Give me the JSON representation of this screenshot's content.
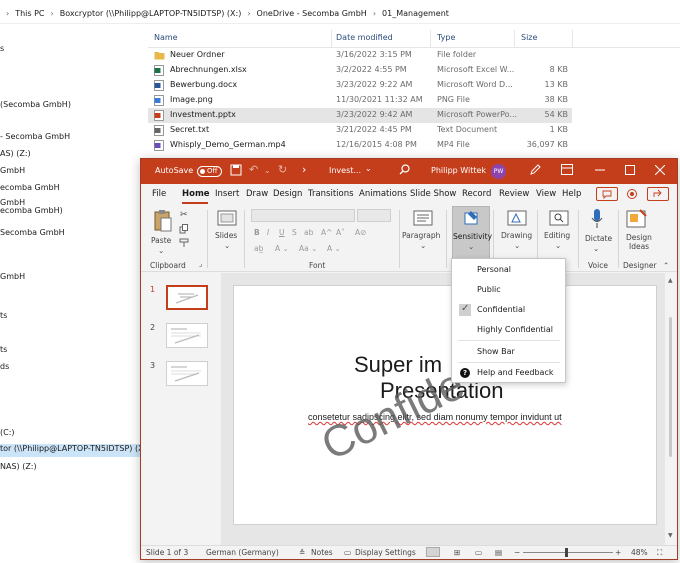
{
  "explorer": {
    "breadcrumb": [
      "This PC",
      "Boxcryptor (\\\\Philipp@LAPTOP-TN5IDTSP) (X:)",
      "OneDrive - Secomba GmbH",
      "01_Management"
    ],
    "nav_items": [
      "s",
      "(Secomba GmbH)",
      "- Secomba GmbH",
      "AS) (Z:)",
      "GmbH",
      "ecomba GmbH",
      "GmbH",
      "ecomba GmbH)",
      "Secomba GmbH",
      "GmbH",
      "ts",
      "ts",
      "ds",
      "(C:)",
      "tor (\\\\Philipp@LAPTOP-TN5IDTSP) (X:)",
      "NAS) (Z:)"
    ],
    "columns": {
      "name": "Name",
      "date": "Date modified",
      "type": "Type",
      "size": "Size"
    },
    "files": [
      {
        "name": "Neuer Ordner",
        "date": "3/16/2022 3:15 PM",
        "type": "File folder",
        "size": "",
        "icon": "folder-icon",
        "color": "#e8b84a"
      },
      {
        "name": "Abrechnungen.xlsx",
        "date": "3/2/2022 4:55 PM",
        "type": "Microsoft Excel W...",
        "size": "8 KB",
        "icon": "excel-file-icon",
        "color": "#1e7145"
      },
      {
        "name": "Bewerbung.docx",
        "date": "3/23/2022 9:22 AM",
        "type": "Microsoft Word D...",
        "size": "13 KB",
        "icon": "word-file-icon",
        "color": "#2b579a"
      },
      {
        "name": "Image.png",
        "date": "11/30/2021 11:32 AM",
        "type": "PNG File",
        "size": "38 KB",
        "icon": "image-file-icon",
        "color": "#3a7bd5"
      },
      {
        "name": "Investment.pptx",
        "date": "3/23/2022 9:42 AM",
        "type": "Microsoft PowerPo...",
        "size": "54 KB",
        "icon": "powerpoint-file-icon",
        "color": "#c43e1c"
      },
      {
        "name": "Secret.txt",
        "date": "3/21/2022 4:45 PM",
        "type": "Text Document",
        "size": "1 KB",
        "icon": "text-file-icon",
        "color": "#666666"
      },
      {
        "name": "Whisply_Demo_German.mp4",
        "date": "12/16/2015 4:08 PM",
        "type": "MP4 File",
        "size": "36,097 KB",
        "icon": "video-file-icon",
        "color": "#6a4fb6"
      }
    ]
  },
  "ppt": {
    "autosave": "AutoSave",
    "autosave_state": "Off",
    "doc_title": "Invest...",
    "user_name": "Philipp Wittek",
    "user_initials": "PW",
    "accent": "#c43e1c",
    "tabs": [
      "File",
      "Home",
      "Insert",
      "Draw",
      "Design",
      "Transitions",
      "Animations",
      "Slide Show",
      "Record",
      "Review",
      "View",
      "Help"
    ],
    "ribbon": {
      "paste": "Paste",
      "clipboard": "Clipboard",
      "slides": "Slides",
      "font": "Font",
      "paragraph": "Paragraph",
      "sensitivity": "Sensitivity",
      "drawing": "Drawing",
      "editing": "Editing",
      "dictate": "Dictate",
      "voice": "Voice",
      "design_ideas_1": "Design",
      "design_ideas_2": "Ideas",
      "designer": "Designer"
    },
    "thumb_numbers": [
      "1",
      "2",
      "3"
    ],
    "slide": {
      "title_line1": "Super im",
      "title_line2": "Presentation",
      "body": "consetetur sadipscing elitr, sed diam nonumy tempor invidunt ut",
      "watermark": "Confide"
    },
    "status": {
      "slide": "Slide 1 of 3",
      "language": "German (Germany)",
      "notes": "Notes",
      "display": "Display Settings",
      "zoom": "48%"
    },
    "sensitivity_menu": {
      "items": [
        "Personal",
        "Public",
        "Confidential",
        "Highly Confidential"
      ],
      "selected": "Confidential",
      "show_bar": "Show Bar",
      "help": "Help and Feedback"
    }
  }
}
